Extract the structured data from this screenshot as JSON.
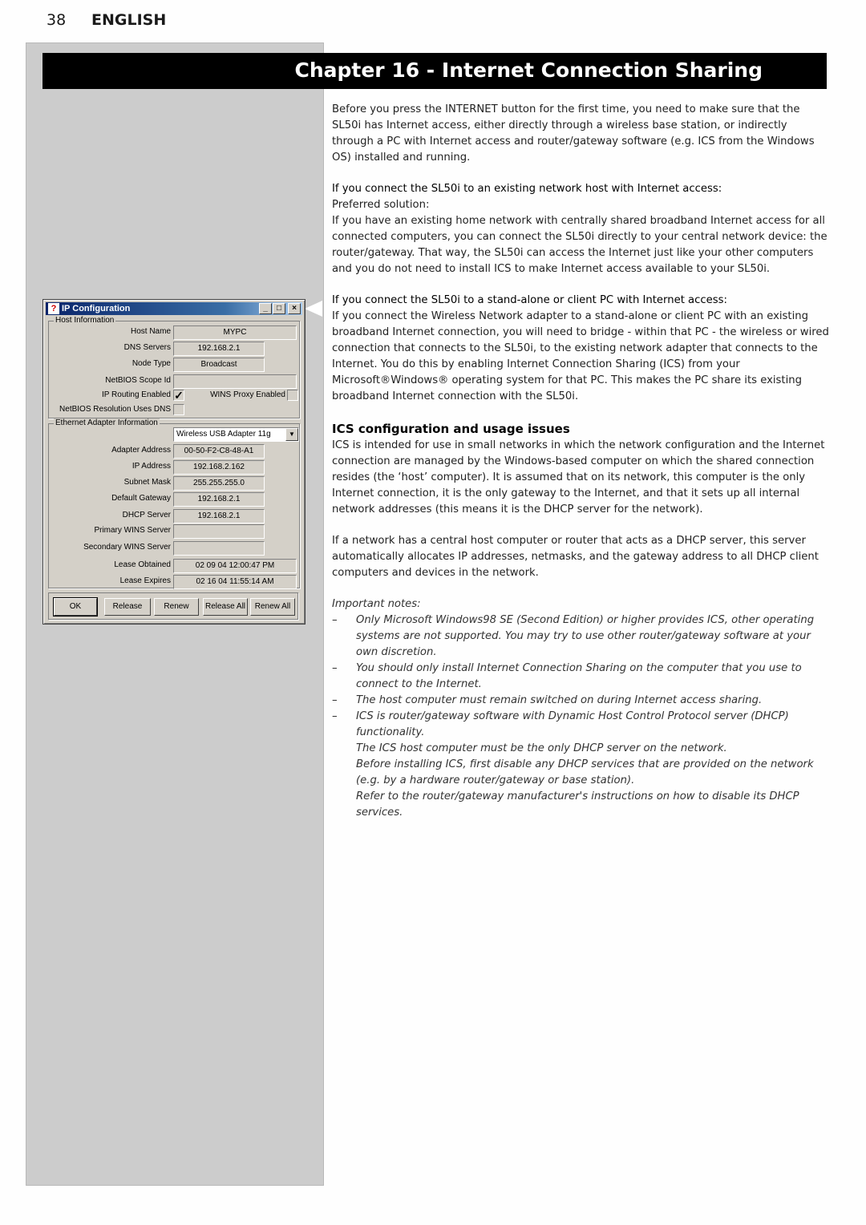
{
  "header": {
    "page_number": "38",
    "language": "ENGLISH"
  },
  "chapter": {
    "title": "Chapter 16 - Internet Connection Sharing"
  },
  "content": {
    "intro": "Before you press the INTERNET button for the first time, you need to make sure that the SL50i has Internet access, either directly through a wireless base station, or indirectly through a PC with Internet access and router/gateway software (e.g. ICS from the Windows OS) installed and running.",
    "section1": {
      "lead": "If you connect the SL50i to an existing network host with Internet access:",
      "sub": "Preferred solution:",
      "body": "If you have an existing home network with centrally shared broadband Internet access for all connected computers, you can connect the SL50i directly to your central network device: the router/gateway. That way, the SL50i can access the Internet just like your other computers and you do not need to install ICS to make Internet access available to your SL50i."
    },
    "section2": {
      "lead": "If you connect the SL50i to a stand-alone or client PC with Internet access:",
      "body": "If you connect the Wireless Network adapter to a stand-alone or client PC with an existing broadband Internet connection, you will need to bridge - within that PC - the wireless or wired connection that connects to the SL50i, to the existing network adapter that connects to the Internet. You do this by enabling Internet Connection Sharing (ICS) from your Microsoft®Windows® operating system for that PC. This makes the PC share its existing broadband Internet connection with the SL50i."
    },
    "ics": {
      "heading": "ICS configuration and usage issues",
      "p1": "ICS is intended for use in small networks in which the network configuration and the Internet connection are managed by the Windows-based computer on which the shared connection resides (the ‘host’ computer). It is assumed that on its network, this computer is the only Internet connection, it is the only gateway to the Internet, and that it sets up all internal network addresses (this means it is the DHCP server for the network).",
      "p2": "If a network has a central host computer or router that acts as a DHCP server, this server automatically allocates IP addresses, netmasks, and the gateway address to all DHCP client computers and devices in the network."
    },
    "notes": {
      "label": "Important notes:",
      "dash": "–",
      "items": [
        {
          "text": "Only Microsoft Windows98 SE (Second Edition) or higher provides ICS, other operating systems are not supported. You may try to use other router/gateway software at your own discretion."
        },
        {
          "text": "You should only install Internet Connection Sharing on the computer that you use to connect to the Internet."
        },
        {
          "text": "The host computer must remain switched on during Internet access sharing."
        },
        {
          "text": "ICS is router/gateway software with Dynamic Host Control Protocol server (DHCP) functionality.",
          "extra1": "The ICS host computer must be the only DHCP server on the network.",
          "extra2": "Before installing ICS, first disable any DHCP services that are provided on the network (e.g. by a hardware router/gateway or base station).",
          "extra3": "Refer to the router/gateway manufacturer's instructions on how to disable its DHCP services."
        }
      ]
    }
  },
  "dialog": {
    "title": "IP Configuration",
    "icon": "help-network-icon",
    "controls": {
      "minimize": "_",
      "maximize": "□",
      "close": "×"
    },
    "host_group": "Host Information",
    "host": {
      "host_name_label": "Host Name",
      "host_name": "MYPC",
      "dns_label": "DNS Servers",
      "dns": "192.168.2.1",
      "node_type_label": "Node Type",
      "node_type": "Broadcast",
      "scope_label": "NetBIOS Scope Id",
      "scope": "",
      "ip_routing_label": "IP Routing Enabled",
      "ip_routing_checked": true,
      "check_glyph": "✓",
      "wins_proxy_label": "WINS Proxy Enabled",
      "wins_proxy_checked": false,
      "netbios_dns_label": "NetBIOS Resolution Uses DNS",
      "netbios_dns_checked": false
    },
    "adapter_group": "Ethernet  Adapter Information",
    "adapter": {
      "selected": "Wireless USB Adapter 11g",
      "dropdown_glyph": "▼",
      "address_label": "Adapter Address",
      "address": "00-50-F2-C8-48-A1",
      "ip_label": "IP Address",
      "ip": "192.168.2.162",
      "mask_label": "Subnet Mask",
      "mask": "255.255.255.0",
      "gateway_label": "Default Gateway",
      "gateway": "192.168.2.1",
      "dhcp_label": "DHCP Server",
      "dhcp": "192.168.2.1",
      "wins1_label": "Primary WINS Server",
      "wins1": "",
      "wins2_label": "Secondary WINS Server",
      "wins2": "",
      "obtained_label": "Lease Obtained",
      "obtained": "02 09 04 12:00:47 PM",
      "expires_label": "Lease Expires",
      "expires": "02 16 04 11:55:14 AM"
    },
    "buttons": {
      "ok": "OK",
      "release": "Release",
      "renew": "Renew",
      "release_all": "Release All",
      "renew_all": "Renew All"
    }
  }
}
